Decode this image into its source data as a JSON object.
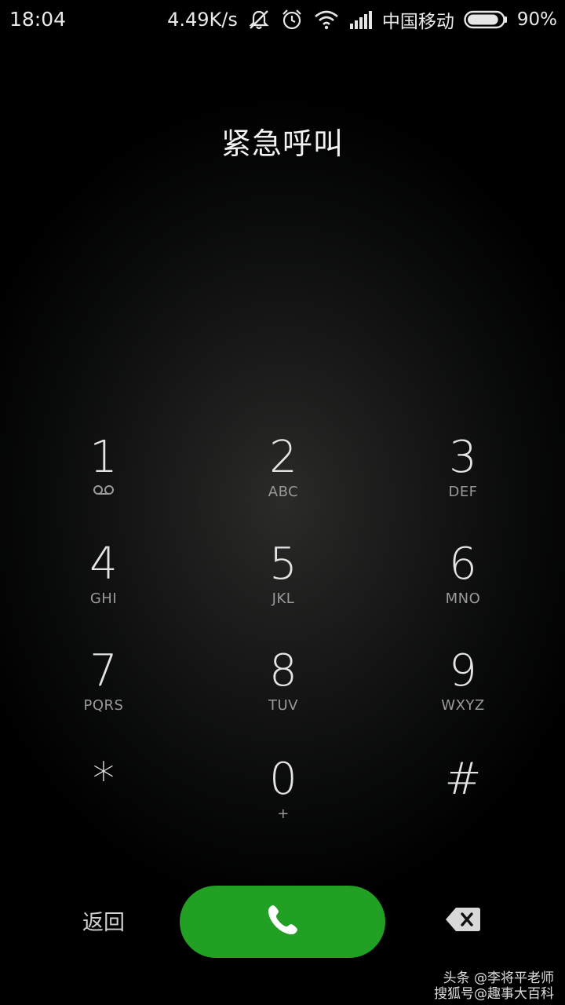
{
  "status_bar": {
    "time": "18:04",
    "net_speed": "4.49K/s",
    "carrier": "中国移动",
    "battery_percent": "90%",
    "battery_level": 0.9,
    "icons": [
      "mute-icon",
      "alarm-icon",
      "wifi-icon",
      "signal-icon",
      "battery-icon"
    ]
  },
  "title": "紧急呼叫",
  "keypad": [
    {
      "digit": "1",
      "letters": "",
      "sub_icon": "voicemail-icon"
    },
    {
      "digit": "2",
      "letters": "ABC"
    },
    {
      "digit": "3",
      "letters": "DEF"
    },
    {
      "digit": "4",
      "letters": "GHI"
    },
    {
      "digit": "5",
      "letters": "JKL"
    },
    {
      "digit": "6",
      "letters": "MNO"
    },
    {
      "digit": "7",
      "letters": "PQRS"
    },
    {
      "digit": "8",
      "letters": "TUV"
    },
    {
      "digit": "9",
      "letters": "WXYZ"
    },
    {
      "digit": "*",
      "letters": ""
    },
    {
      "digit": "0",
      "letters": "+"
    },
    {
      "digit": "#",
      "letters": ""
    }
  ],
  "bottom_bar": {
    "back_label": "返回",
    "call_icon": "phone-icon",
    "delete_icon": "backspace-icon"
  },
  "watermark": {
    "line1": "头条 @李将平老师",
    "line2": "搜狐号@趣事大百科"
  },
  "colors": {
    "call_button": "#21a024",
    "background": "#000000"
  }
}
